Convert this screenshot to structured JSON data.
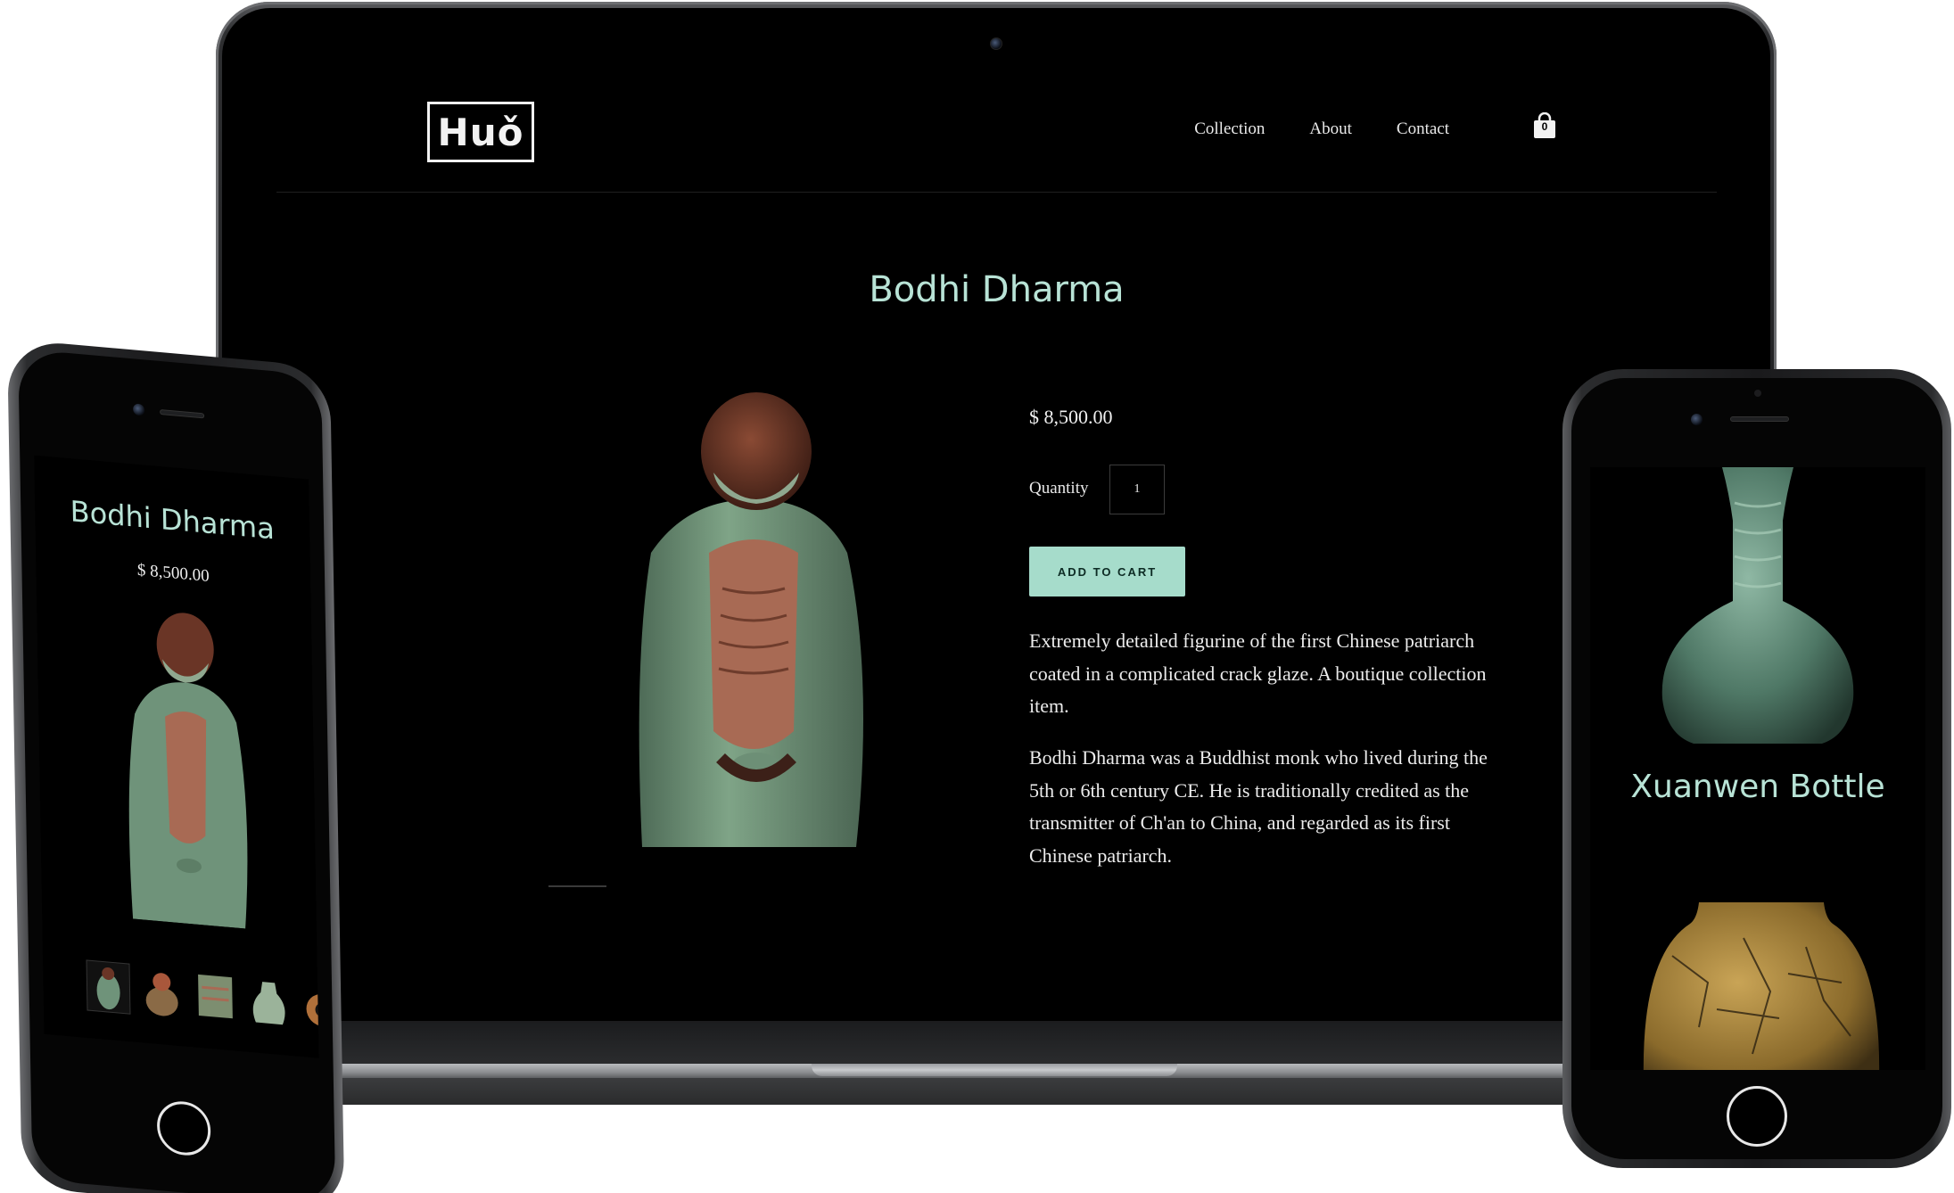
{
  "desktop": {
    "nav": {
      "logo_text": "Huǒ",
      "links": [
        "Collection",
        "About",
        "Contact"
      ],
      "cart_count": "0"
    },
    "product": {
      "title": "Bodhi Dharma",
      "price": "$ 8,500.00",
      "quantity_label": "Quantity",
      "quantity_value": "1",
      "add_to_cart_label": "ADD TO CART",
      "description_1": "Extremely detailed figurine of the first Chinese patriarch coated in a complicated crack glaze. A boutique collection item.",
      "description_2": "Bodhi Dharma was a Buddhist monk who lived during the 5th or 6th century CE. He is traditionally credited as the transmitter of Ch'an to China, and regarded as its first Chinese patriarch."
    }
  },
  "phone_left": {
    "title": "Bodhi Dharma",
    "price": "$ 8,500.00"
  },
  "phone_right": {
    "title": "Xuanwen Bottle"
  },
  "colors": {
    "accent": "#a6dccb",
    "title_text": "#b8e3d6",
    "background": "#000000"
  }
}
